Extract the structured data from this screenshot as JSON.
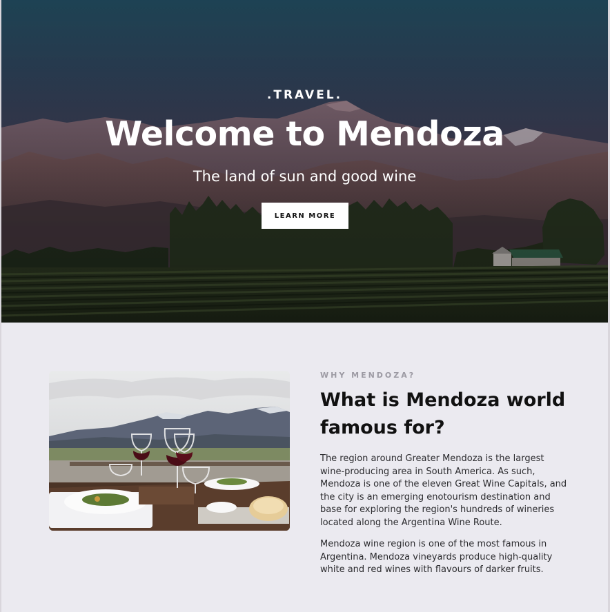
{
  "hero": {
    "eyebrow": ".TRAVEL.",
    "title": "Welcome to Mendoza",
    "subtitle": "The land of sun and good wine",
    "button_label": "LEARN MORE"
  },
  "about": {
    "kicker": "WHY MENDOZA?",
    "title": "What is Mendoza world famous for?",
    "paragraphs": [
      "The region around Greater Mendoza is the largest wine-producing area in South America. As such, Mendoza is one of the eleven Great Wine Capitals, and the city is an emerging enotourism destination and base for exploring the region's hundreds of wineries located along the Argentina Wine Route.",
      "Mendoza wine region is one of the most famous in Argentina. Mendoza vineyards produce high-quality white and red wines with flavours of darker fruits."
    ]
  },
  "colors": {
    "hero_sky_top": "#1f4658",
    "section_background": "#ebeaf0",
    "button_background": "#ffffff",
    "kicker_text": "#9c9aa3",
    "title_text": "#111111"
  }
}
